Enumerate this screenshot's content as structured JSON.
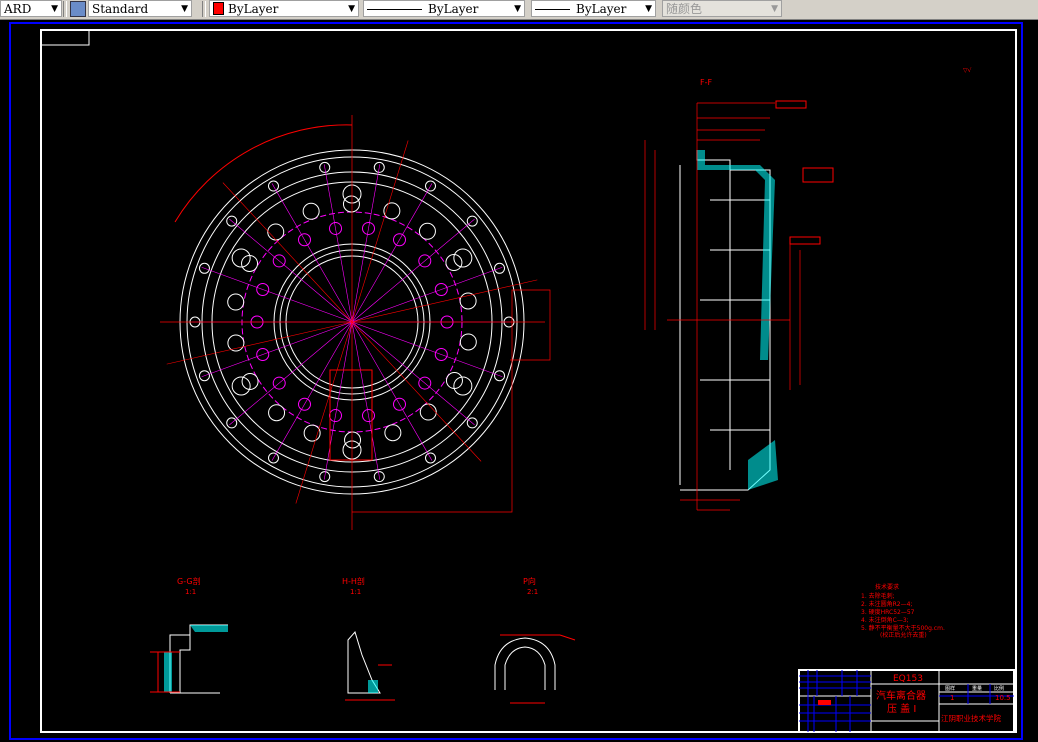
{
  "toolbar": {
    "text_style_partial": "ARD",
    "dim_style": "Standard",
    "layer_color": "ByLayer",
    "linetype": "ByLayer",
    "lineweight": "ByLayer",
    "plot_style": "随颜色",
    "layer_color_hex": "#ff0000"
  },
  "drawing": {
    "section_ff": "F-F",
    "views": [
      {
        "label": "G-G剖",
        "scale": "1:1"
      },
      {
        "label": "H-H剖",
        "scale": "1:1"
      },
      {
        "label": "P向",
        "scale": "2:1"
      }
    ],
    "notes_title": "技术要求",
    "notes": [
      "1. 去除毛刺;",
      "2. 未注圆角R2—4;",
      "3. 硬度HRC52—57",
      "4. 未注倒角C—3;",
      "5. 静不平衡量不大于500g.cm.",
      "(校正后允许去重)"
    ]
  },
  "title_block": {
    "code": "EQ153",
    "title_line1": "汽车离合器",
    "title_line2": "压 盖 I",
    "col_headers": [
      "图样",
      "重量",
      "比例"
    ],
    "quantity": "1",
    "scale": "10.5",
    "school": "江阴职业技术学院"
  },
  "colors": {
    "red": "#ff0000",
    "magenta": "#ff00ff",
    "cyan": "#00ffff",
    "blue": "#0000ff",
    "white": "#ffffff"
  }
}
